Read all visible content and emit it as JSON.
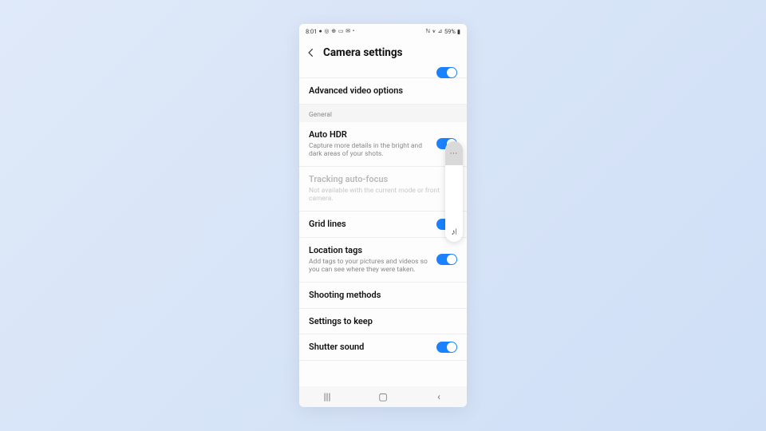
{
  "status": {
    "time": "8:01",
    "left_icons": "● ◎ ⊕ ▭ ✉ •",
    "right_icons": "ℕ ⩛ ⊿",
    "battery": "59%"
  },
  "header": {
    "title": "Camera settings"
  },
  "section": "General",
  "rows": {
    "advanced": {
      "title": "Advanced video options"
    },
    "autohdr": {
      "title": "Auto HDR",
      "sub": "Capture more details in the bright and dark areas of your shots."
    },
    "tracking": {
      "title": "Tracking auto-focus",
      "sub": "Not available with the current mode or front camera."
    },
    "grid": {
      "title": "Grid lines"
    },
    "location": {
      "title": "Location tags",
      "sub": "Add tags to your pictures and videos so you can see where they were taken."
    },
    "shooting": {
      "title": "Shooting methods"
    },
    "keep": {
      "title": "Settings to keep"
    },
    "shutter": {
      "title": "Shutter sound"
    }
  },
  "volume": {
    "dots": "⋯",
    "icon": "♪⦚"
  },
  "nav": {
    "recents": "|||",
    "home": "▢",
    "back": "‹"
  }
}
